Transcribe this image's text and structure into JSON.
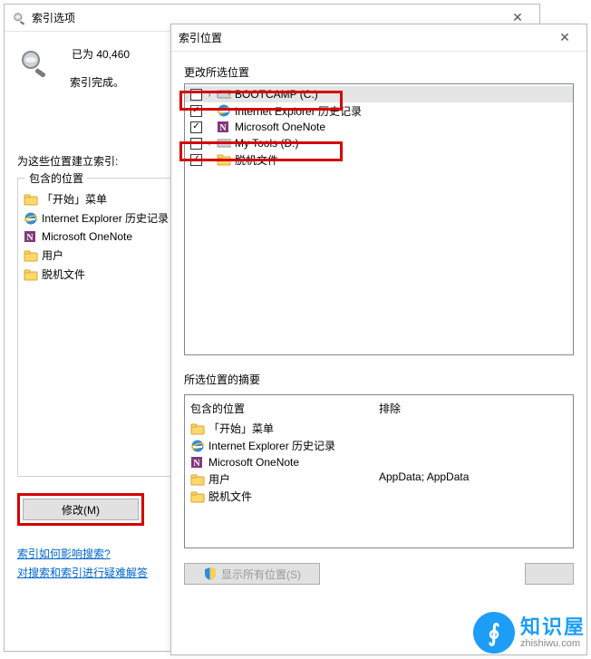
{
  "back": {
    "title": "索引选项",
    "status_count": "已为 40,460",
    "status_done": "索引完成。",
    "section_label": "为这些位置建立索引:",
    "group_legend": "包含的位置",
    "locations": [
      {
        "icon": "folder",
        "label": "「开始」菜单"
      },
      {
        "icon": "ie",
        "label": "Internet Explorer 历史记录"
      },
      {
        "icon": "onenote",
        "label": "Microsoft OneNote"
      },
      {
        "icon": "folder",
        "label": "用户"
      },
      {
        "icon": "folder",
        "label": "脱机文件"
      }
    ],
    "modify_btn": "修改(M)",
    "link1": "索引如何影响搜索?",
    "link2": "对搜索和索引进行疑难解答"
  },
  "front": {
    "title": "索引位置",
    "change_label": "更改所选位置",
    "tree": [
      {
        "checked": false,
        "expander": true,
        "icon": "drive",
        "label": "BOOTCAMP (C:)",
        "selected": true,
        "hl": true
      },
      {
        "checked": true,
        "expander": false,
        "icon": "ie",
        "label": "Internet Explorer 历史记录"
      },
      {
        "checked": true,
        "expander": false,
        "icon": "onenote",
        "label": "Microsoft OneNote"
      },
      {
        "checked": false,
        "expander": true,
        "icon": "drive",
        "label": "My Tools (D:)",
        "hl": true
      },
      {
        "checked": true,
        "expander": false,
        "icon": "folder",
        "label": "脱机文件"
      }
    ],
    "summary_label": "所选位置的摘要",
    "col_included": "包含的位置",
    "col_excluded": "排除",
    "summary": [
      {
        "icon": "folder",
        "label": "「开始」菜单",
        "excluded": ""
      },
      {
        "icon": "ie",
        "label": "Internet Explorer 历史记录",
        "excluded": ""
      },
      {
        "icon": "onenote",
        "label": "Microsoft OneNote",
        "excluded": ""
      },
      {
        "icon": "folder",
        "label": "用户",
        "excluded": "AppData; AppData"
      },
      {
        "icon": "folder",
        "label": "脱机文件",
        "excluded": ""
      }
    ],
    "show_all_btn": "显示所有位置(S)"
  },
  "watermark": {
    "title": "知识屋",
    "url": "zhishiwu.com",
    "glyph": "∮"
  }
}
